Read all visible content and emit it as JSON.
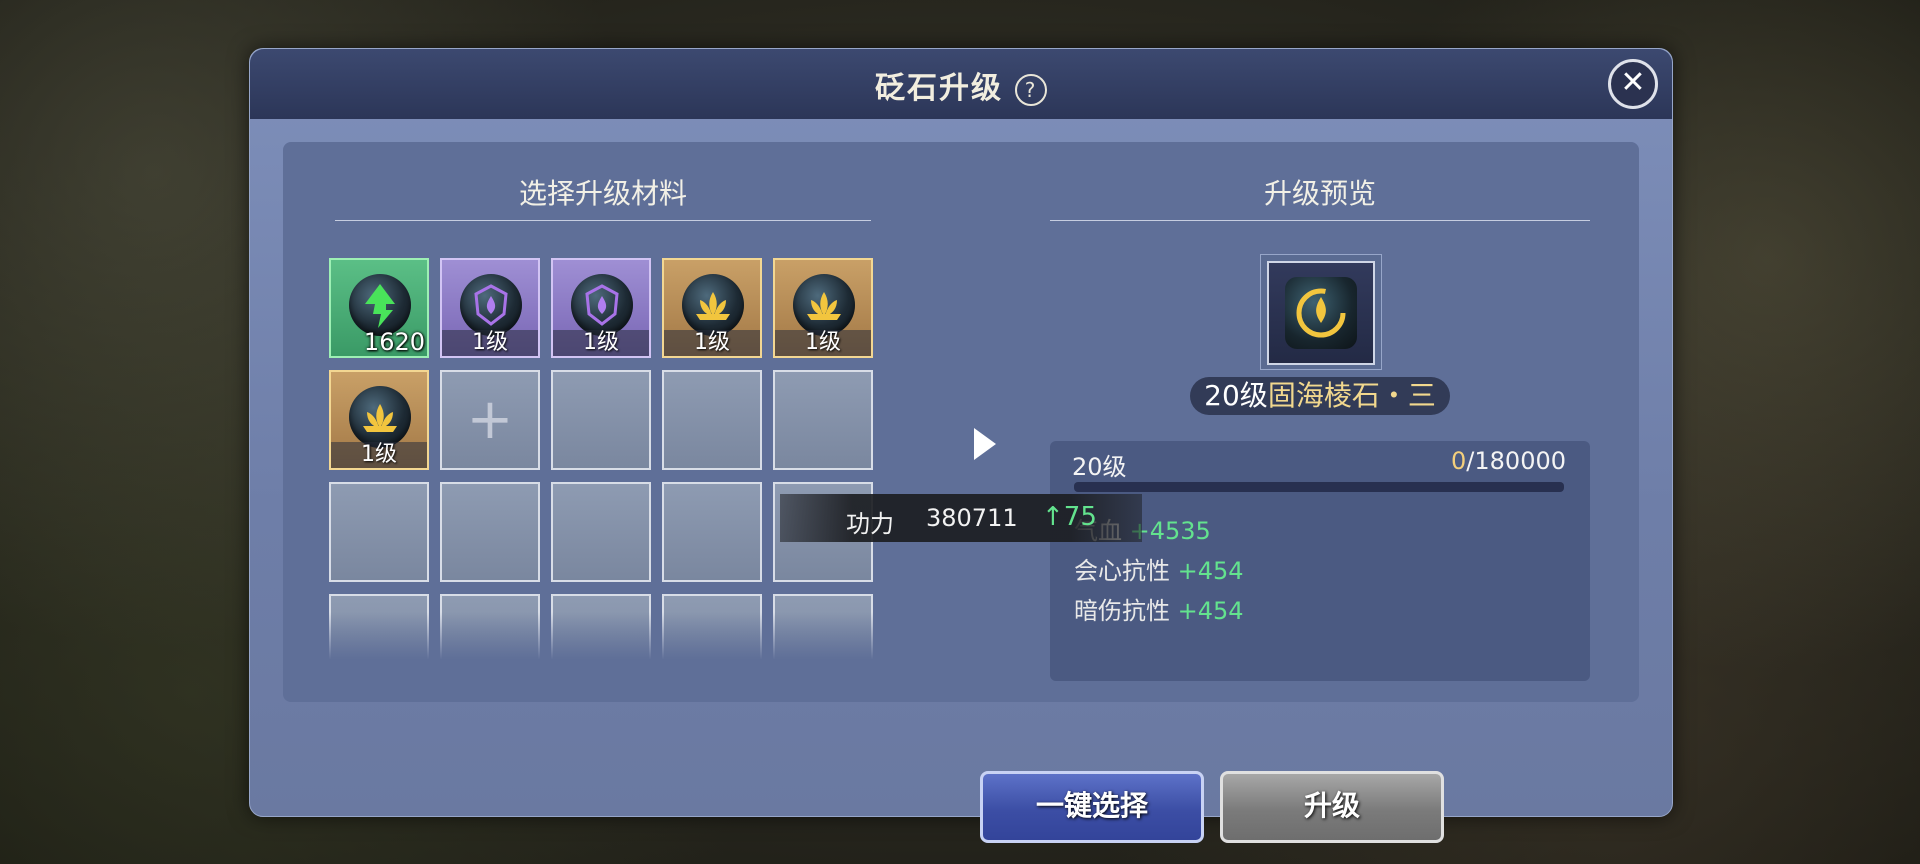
{
  "dialog": {
    "title": "砭石升级",
    "help_label": "?",
    "close_label": "✕"
  },
  "left_section": {
    "title": "选择升级材料",
    "slots": [
      {
        "type": "green",
        "icon": "green-arrow-gem",
        "qty": "1620"
      },
      {
        "type": "purple",
        "icon": "purple-drop-gem",
        "level": "1级"
      },
      {
        "type": "purple",
        "icon": "purple-drop-gem",
        "level": "1级"
      },
      {
        "type": "gold",
        "icon": "gold-lotus-gem",
        "level": "1级"
      },
      {
        "type": "gold",
        "icon": "gold-lotus-gem",
        "level": "1级"
      },
      {
        "type": "gold",
        "icon": "gold-lotus-gem",
        "level": "1级"
      },
      {
        "type": "add",
        "label": "+"
      }
    ]
  },
  "right_section": {
    "title": "升级预览",
    "preview_icon": "gold-drop-gem",
    "item_level": "20级",
    "item_name": "固海棱石・三",
    "stats_level": "20级",
    "exp_current": "0",
    "exp_total": "/180000",
    "stats": [
      {
        "name": "气血",
        "value": "+4535"
      },
      {
        "name": "会心抗性",
        "value": "+454"
      },
      {
        "name": "暗伤抗性",
        "value": "+454"
      }
    ]
  },
  "power": {
    "label": "功力",
    "value": "380711",
    "increase": "75"
  },
  "buttons": {
    "auto_select": "一键选择",
    "upgrade": "升级"
  },
  "colors": {
    "dialog_bg": "#7e8fba",
    "titlebar": "#2c3658",
    "stat_green": "#63e38e",
    "name_gold": "#f2d88e"
  }
}
